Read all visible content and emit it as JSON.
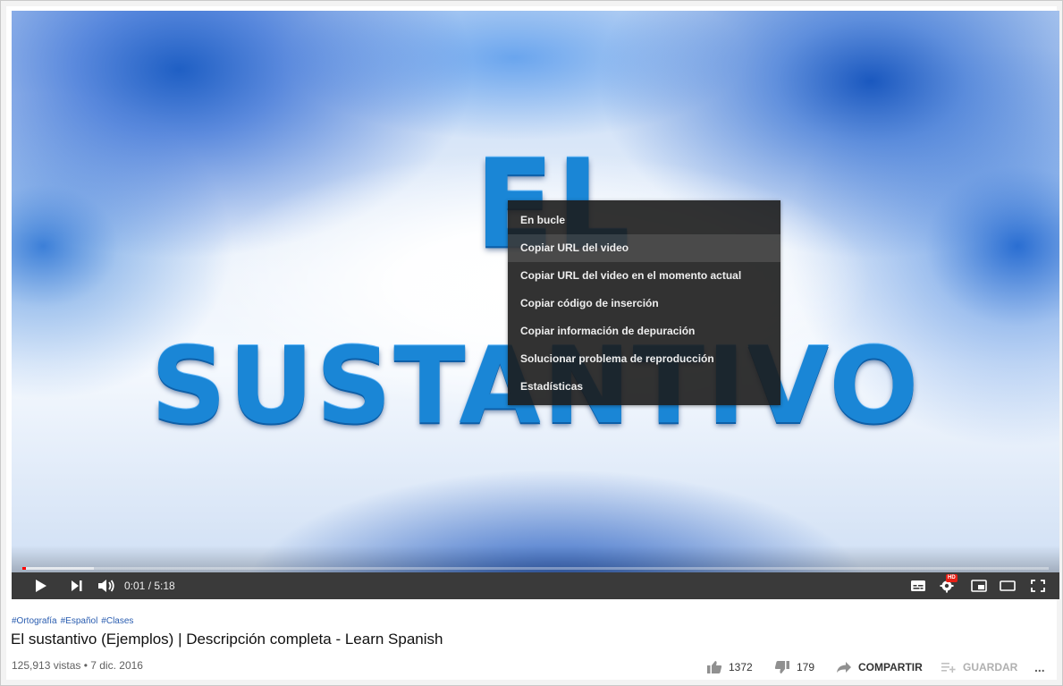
{
  "video": {
    "overlay_word_1": "EL",
    "overlay_word_2": "SUSTANTIVO"
  },
  "context_menu": {
    "items": [
      {
        "label": "En bucle"
      },
      {
        "label": "Copiar URL del video"
      },
      {
        "label": "Copiar URL del video en el momento actual"
      },
      {
        "label": "Copiar código de inserción"
      },
      {
        "label": "Copiar información de depuración"
      },
      {
        "label": "Solucionar problema de reproducción"
      },
      {
        "label": "Estadísticas"
      }
    ]
  },
  "player": {
    "time_display": "0:01 / 5:18",
    "progress_fraction": 0.0031,
    "buffered_fraction": 0.07,
    "hd_badge": "HD",
    "icons": [
      "play-icon",
      "next-icon",
      "volume-icon",
      "subtitles-icon",
      "settings-icon",
      "miniplayer-icon",
      "theater-icon",
      "fullscreen-icon"
    ]
  },
  "meta": {
    "hashtags": [
      "#Ortografía",
      "#Español",
      "#Clases"
    ],
    "title": "El sustantivo (Ejemplos) | Descripción completa - Learn Spanish",
    "views_date": "125,913 vistas • 7 dic. 2016",
    "likes": "1372",
    "dislikes": "179",
    "share_label": "COMPARTIR",
    "save_label": "GUARDAR",
    "more": "..."
  },
  "colors": {
    "accent_red": "#ff0000",
    "hashtag_blue": "#2a5db0"
  }
}
